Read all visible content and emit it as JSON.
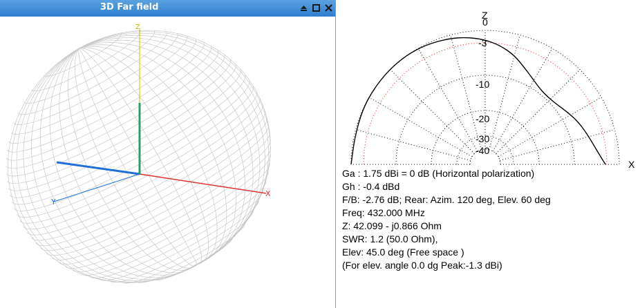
{
  "window": {
    "title": "3D Far field",
    "buttons": [
      {
        "name": "shade-icon"
      },
      {
        "name": "maximize-icon"
      },
      {
        "name": "close-icon"
      }
    ]
  },
  "view3d": {
    "axis_labels": {
      "x": "X",
      "y": "Y",
      "z": "Z"
    },
    "colors": {
      "mesh": "#c8c8c8",
      "x_axis": "#e03030",
      "y_axis": "#1e6fd8",
      "z_axis": "#2a9d6a",
      "z_axis_tip": "#c8c000"
    }
  },
  "polar": {
    "axis_labels": {
      "vertical": "Z",
      "horizontal": "X"
    },
    "ring_labels": [
      "0",
      "-3",
      "-10",
      "-20",
      "-30",
      "-40"
    ],
    "colors": {
      "grid": "#000000",
      "ref_ring": "#e02020",
      "pattern": "#000000"
    }
  },
  "info": {
    "lines": [
      "Ga : 1.75 dBi = 0 dB  (Horizontal polarization)",
      "Gh : -0.4 dBd",
      "F/B: -2.76 dB; Rear: Azim. 120 deg,  Elev. 60 deg",
      "Freq: 432.000 MHz",
      "Z: 42.099 - j0.866 Ohm",
      "SWR: 1.2 (50.0 Ohm),",
      "Elev: 45.0 deg (Free space )",
      "(For elev. angle 0.0 dg Peak:-1.3 dBi)"
    ]
  }
}
